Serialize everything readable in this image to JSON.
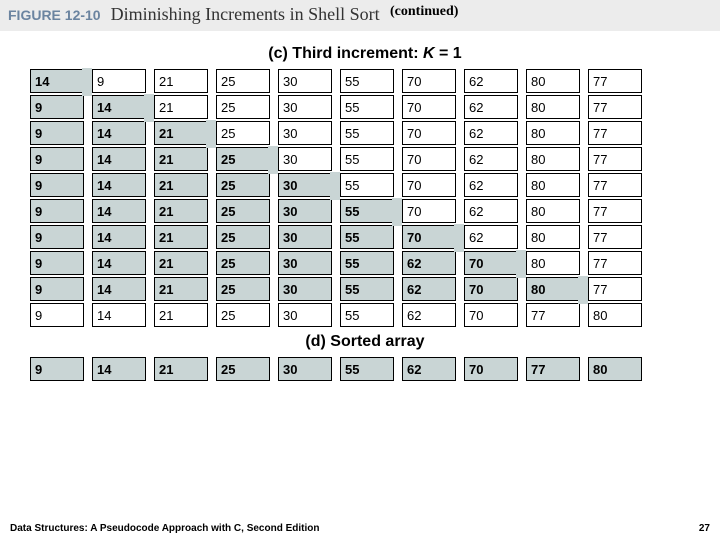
{
  "header": {
    "figure_label": "FIGURE 12-10",
    "figure_title": "Diminishing Increments in Shell Sort",
    "continued": "(continued)"
  },
  "section_c": {
    "title_prefix": "(c) Third increment: ",
    "var": "K",
    "eq": " = 1"
  },
  "chart_data": {
    "type": "table",
    "title": "Shell Sort third increment passes (K=1) and final sorted array",
    "columns": 10,
    "rows": [
      {
        "values": [
          14,
          9,
          21,
          25,
          30,
          55,
          70,
          62,
          80,
          77
        ],
        "boldTo": 0,
        "marker_after": 0
      },
      {
        "values": [
          9,
          14,
          21,
          25,
          30,
          55,
          70,
          62,
          80,
          77
        ],
        "boldTo": 1,
        "marker_after": 1
      },
      {
        "values": [
          9,
          14,
          21,
          25,
          30,
          55,
          70,
          62,
          80,
          77
        ],
        "boldTo": 2,
        "marker_after": 2
      },
      {
        "values": [
          9,
          14,
          21,
          25,
          30,
          55,
          70,
          62,
          80,
          77
        ],
        "boldTo": 3,
        "marker_after": 3
      },
      {
        "values": [
          9,
          14,
          21,
          25,
          30,
          55,
          70,
          62,
          80,
          77
        ],
        "boldTo": 4,
        "marker_after": 4
      },
      {
        "values": [
          9,
          14,
          21,
          25,
          30,
          55,
          70,
          62,
          80,
          77
        ],
        "boldTo": 5,
        "marker_after": 5
      },
      {
        "values": [
          9,
          14,
          21,
          25,
          30,
          55,
          70,
          62,
          80,
          77
        ],
        "boldTo": 6,
        "marker_after": 6
      },
      {
        "values": [
          9,
          14,
          21,
          25,
          30,
          55,
          62,
          70,
          80,
          77
        ],
        "boldTo": 7,
        "marker_after": 7
      },
      {
        "values": [
          9,
          14,
          21,
          25,
          30,
          55,
          62,
          70,
          80,
          77
        ],
        "boldTo": 8,
        "marker_after": 8
      },
      {
        "values": [
          9,
          14,
          21,
          25,
          30,
          55,
          62,
          70,
          77,
          80
        ],
        "boldTo": -1,
        "marker_after": -1
      }
    ],
    "sorted": [
      9,
      14,
      21,
      25,
      30,
      55,
      62,
      70,
      77,
      80
    ]
  },
  "section_d": {
    "title": "(d) Sorted array"
  },
  "footer": {
    "left": "Data Structures: A Pseudocode Approach with C, Second Edition",
    "right": "27"
  }
}
